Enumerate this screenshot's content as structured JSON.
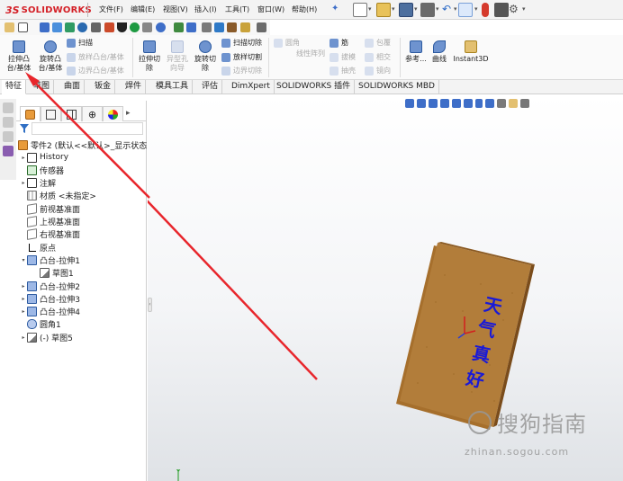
{
  "app": {
    "logo_ds": "3S",
    "logo_name": "SOLIDWORKS",
    "menu": [
      "文件(F)",
      "编辑(E)",
      "视图(V)",
      "插入(I)",
      "工具(T)",
      "窗口(W)",
      "帮助(H)"
    ]
  },
  "command_manager": {
    "extrude_boss_line1": "拉伸凸",
    "extrude_boss_line2": "台/基体",
    "revolve_boss_line1": "旋转凸",
    "revolve_boss_line2": "台/基体",
    "sweep": "扫描",
    "loft_boss": "放样凸台/基体",
    "boundary_boss": "边界凸台/基体",
    "extrude_cut_line1": "拉伸切",
    "extrude_cut_line2": "除",
    "hole_wizard_line1": "异型孔",
    "hole_wizard_line2": "向导",
    "revolve_cut_line1": "旋转切",
    "revolve_cut_line2": "除",
    "swept_cut": "扫描切除",
    "lofted_cut": "放样切割",
    "boundary_cut": "边界切除",
    "fillet": "圆角",
    "linear_pattern": "线性阵列",
    "rib": "筋",
    "draft": "拔模",
    "shell": "抽壳",
    "wrap": "包覆",
    "intersect": "相交",
    "mirror": "镜向",
    "reference": "参考...",
    "curves": "曲线",
    "instant3d": "Instant3D"
  },
  "tabs": [
    "特征",
    "草图",
    "曲面",
    "钣金",
    "焊件",
    "模具工具",
    "评估",
    "DimXpert",
    "SOLIDWORKS 插件",
    "SOLIDWORKS MBD"
  ],
  "feature_tree": {
    "root": "零件2 (默认<<默认>_显示状态",
    "items": [
      {
        "label": "History",
        "icon": "history-icon",
        "toggle": "▸"
      },
      {
        "label": "传感器",
        "icon": "sensor-icon",
        "toggle": ""
      },
      {
        "label": "注解",
        "icon": "annotation-icon",
        "toggle": "▸"
      },
      {
        "label": "材质 <未指定>",
        "icon": "material-icon",
        "toggle": ""
      },
      {
        "label": "前视基准面",
        "icon": "plane-icon",
        "toggle": ""
      },
      {
        "label": "上视基准面",
        "icon": "plane-icon",
        "toggle": ""
      },
      {
        "label": "右视基准面",
        "icon": "plane-icon",
        "toggle": ""
      },
      {
        "label": "原点",
        "icon": "origin-icon",
        "toggle": ""
      },
      {
        "label": "凸台-拉伸1",
        "icon": "extrude-icon",
        "toggle": "▾"
      },
      {
        "label": "草图1",
        "icon": "sketch-icon",
        "toggle": ""
      },
      {
        "label": "凸台-拉伸2",
        "icon": "extrude-icon",
        "toggle": "▸"
      },
      {
        "label": "凸台-拉伸3",
        "icon": "extrude-icon",
        "toggle": "▸"
      },
      {
        "label": "凸台-拉伸4",
        "icon": "extrude-icon",
        "toggle": "▸"
      },
      {
        "label": "圆角1",
        "icon": "fillet-icon",
        "toggle": ""
      },
      {
        "label": "(-) 草图5",
        "icon": "sketch-icon",
        "toggle": "▸"
      }
    ]
  },
  "model": {
    "text_chars": [
      "天",
      "气",
      "真",
      "好"
    ],
    "text_color": "#1a1ad6",
    "board_color": "#b27d3a"
  },
  "watermark": {
    "title": "搜狗指南",
    "url": "zhinan.sogou.com"
  },
  "colors": {
    "annotation_arrow": "#e8262c",
    "brand": "#d41f26"
  }
}
